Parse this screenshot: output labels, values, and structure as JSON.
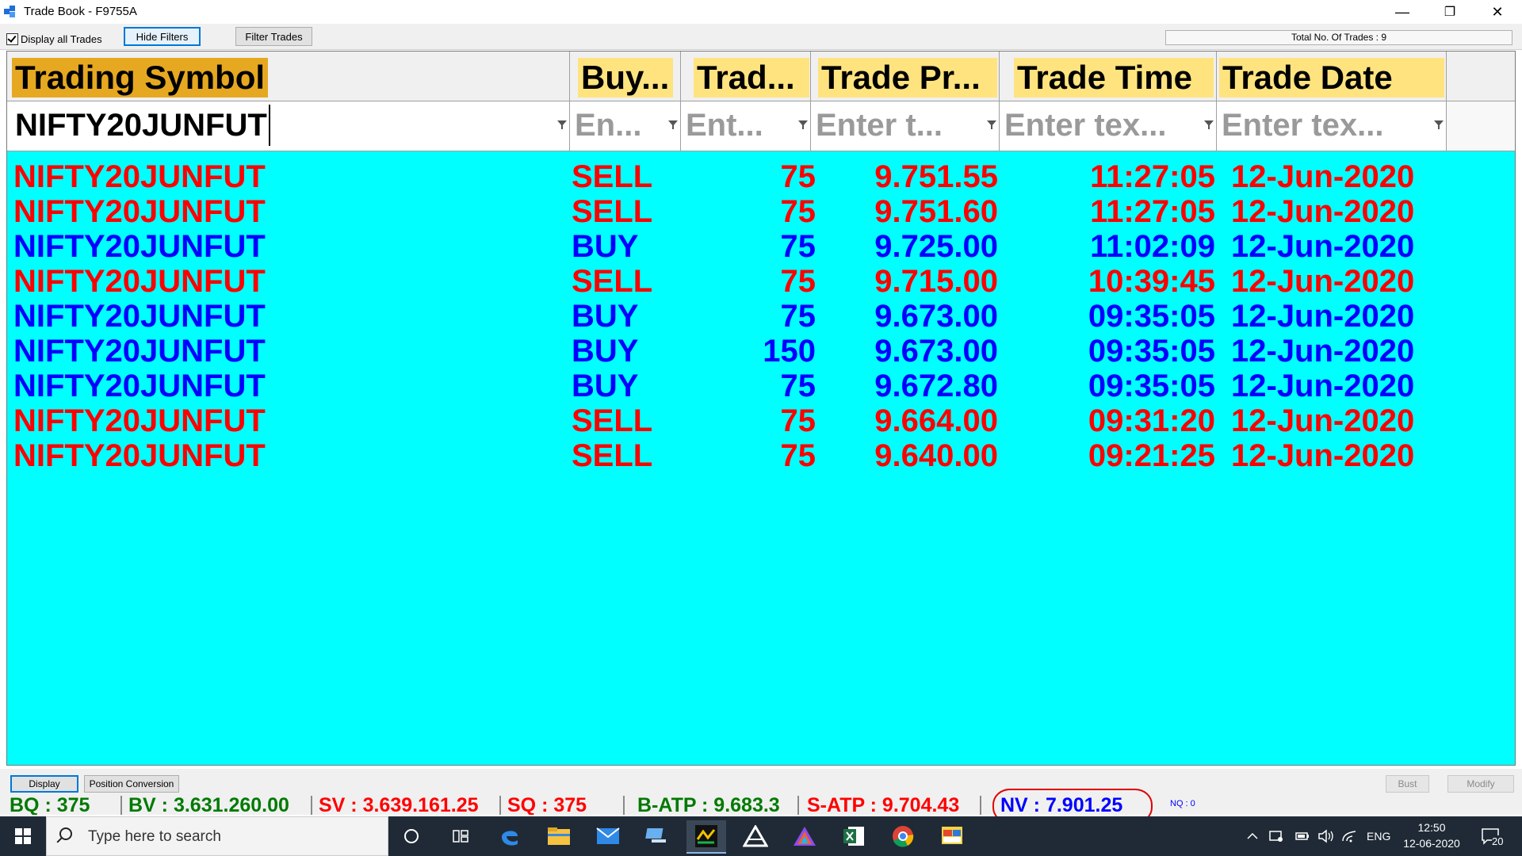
{
  "window": {
    "title": "Trade Book - F9755A",
    "minimize": "—",
    "restore": "❐",
    "close": "✕"
  },
  "toolbar": {
    "display_all_label": "Display all Trades",
    "hide_filters_label": "Hide Filters",
    "filter_trades_label": "Filter Trades",
    "total_trades": "Total No. Of Trades : 9"
  },
  "columns": [
    {
      "label": "Trading Symbol",
      "filter_value": "NIFTY20JUNFUT",
      "filter_placeholder": ""
    },
    {
      "label": "Buy...",
      "filter_value": "",
      "filter_placeholder": "En..."
    },
    {
      "label": "Trad...",
      "filter_value": "",
      "filter_placeholder": "Ent..."
    },
    {
      "label": "Trade Pr...",
      "filter_value": "",
      "filter_placeholder": "Enter t..."
    },
    {
      "label": "Trade Time",
      "filter_value": "",
      "filter_placeholder": "Enter tex..."
    },
    {
      "label": "Trade Date",
      "filter_value": "",
      "filter_placeholder": "Enter tex..."
    }
  ],
  "trades": [
    {
      "symbol": "NIFTY20JUNFUT",
      "side": "SELL",
      "qty": "75",
      "price": "9.751.55",
      "time": "11:27:05",
      "date": "12-Jun-2020"
    },
    {
      "symbol": "NIFTY20JUNFUT",
      "side": "SELL",
      "qty": "75",
      "price": "9.751.60",
      "time": "11:27:05",
      "date": "12-Jun-2020"
    },
    {
      "symbol": "NIFTY20JUNFUT",
      "side": "BUY",
      "qty": "75",
      "price": "9.725.00",
      "time": "11:02:09",
      "date": "12-Jun-2020"
    },
    {
      "symbol": "NIFTY20JUNFUT",
      "side": "SELL",
      "qty": "75",
      "price": "9.715.00",
      "time": "10:39:45",
      "date": "12-Jun-2020"
    },
    {
      "symbol": "NIFTY20JUNFUT",
      "side": "BUY",
      "qty": "75",
      "price": "9.673.00",
      "time": "09:35:05",
      "date": "12-Jun-2020"
    },
    {
      "symbol": "NIFTY20JUNFUT",
      "side": "BUY",
      "qty": "150",
      "price": "9.673.00",
      "time": "09:35:05",
      "date": "12-Jun-2020"
    },
    {
      "symbol": "NIFTY20JUNFUT",
      "side": "BUY",
      "qty": "75",
      "price": "9.672.80",
      "time": "09:35:05",
      "date": "12-Jun-2020"
    },
    {
      "symbol": "NIFTY20JUNFUT",
      "side": "SELL",
      "qty": "75",
      "price": "9.664.00",
      "time": "09:31:20",
      "date": "12-Jun-2020"
    },
    {
      "symbol": "NIFTY20JUNFUT",
      "side": "SELL",
      "qty": "75",
      "price": "9.640.00",
      "time": "09:21:25",
      "date": "12-Jun-2020"
    }
  ],
  "bottom": {
    "display_label": "Display",
    "position_conversion_label": "Position Conversion",
    "bust_label": "Bust",
    "modify_label": "Modify"
  },
  "stats": {
    "bq": "BQ : 375",
    "bv": "BV : 3.631.260.00",
    "sv": "SV : 3.639.161.25",
    "sq": "SQ : 375",
    "b_atp": "B-ATP : 9.683.3",
    "s_atp": "S-ATP : 9.704.43",
    "nv": "NV : 7.901.25",
    "nq": "NQ : 0"
  },
  "taskbar": {
    "search_placeholder": "Type here to search",
    "lang": "ENG",
    "time": "12:50",
    "date": "12-06-2020",
    "notifications": "20"
  },
  "colors": {
    "grid_bg": "#00ffff",
    "sell": "#ff0000",
    "buy": "#0000ff",
    "header_label": "#ffe37f",
    "header_selected": "#e5a820"
  }
}
